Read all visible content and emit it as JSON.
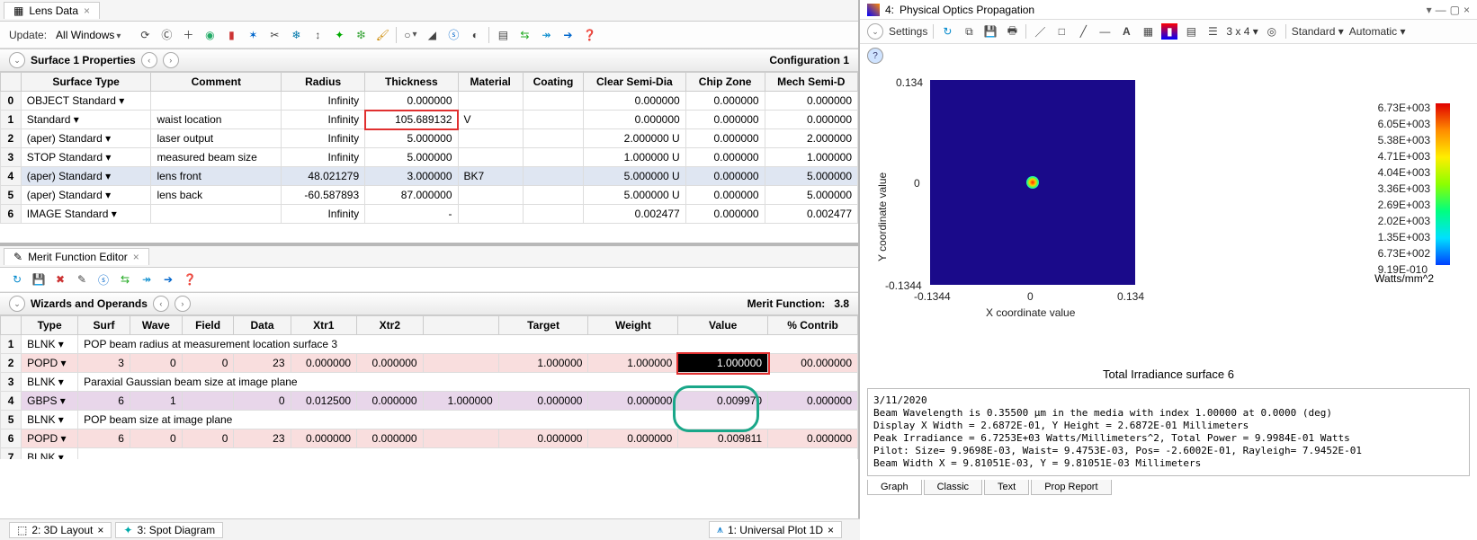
{
  "lens": {
    "tab_label": "Lens Data",
    "update_label": "Update:",
    "update_value": "All Windows",
    "surface_props": "Surface  1 Properties",
    "config_label": "Configuration 1",
    "columns": [
      "",
      "Surface Type",
      "Comment",
      "Radius",
      "Thickness",
      "Material",
      "Coating",
      "Clear Semi-Dia",
      "Chip Zone",
      "Mech Semi-D"
    ],
    "rows": [
      {
        "n": "0",
        "obj": "OBJECT",
        "type": "Standard ▾",
        "comment": "",
        "radius": "Infinity",
        "thickness": "0.000000",
        "material": "",
        "coating": "",
        "csd": "0.000000",
        "chip": "0.000000",
        "mech": "0.000000"
      },
      {
        "n": "1",
        "obj": "",
        "type": "Standard ▾",
        "comment": "waist location",
        "radius": "Infinity",
        "thickness": "105.689132",
        "material": "V",
        "coating": "",
        "csd": "0.000000",
        "chip": "0.000000",
        "mech": "0.000000"
      },
      {
        "n": "2",
        "obj": "(aper)",
        "type": "Standard ▾",
        "comment": "laser output",
        "radius": "Infinity",
        "thickness": "5.000000",
        "material": "",
        "coating": "",
        "csd": "2.000000 U",
        "chip": "0.000000",
        "mech": "2.000000"
      },
      {
        "n": "3",
        "obj": "STOP",
        "type": "Standard ▾",
        "comment": "measured beam size",
        "radius": "Infinity",
        "thickness": "5.000000",
        "material": "",
        "coating": "",
        "csd": "1.000000 U",
        "chip": "0.000000",
        "mech": "1.000000"
      },
      {
        "n": "4",
        "obj": "(aper)",
        "type": "Standard ▾",
        "comment": "lens front",
        "radius": "48.021279",
        "thickness": "3.000000",
        "material": "BK7",
        "coating": "",
        "csd": "5.000000 U",
        "chip": "0.000000",
        "mech": "5.000000"
      },
      {
        "n": "5",
        "obj": "(aper)",
        "type": "Standard ▾",
        "comment": "lens back",
        "radius": "-60.587893",
        "thickness": "87.000000",
        "material": "",
        "coating": "",
        "csd": "5.000000 U",
        "chip": "0.000000",
        "mech": "5.000000"
      },
      {
        "n": "6",
        "obj": "IMAGE",
        "type": "Standard ▾",
        "comment": "",
        "radius": "Infinity",
        "thickness": "-",
        "material": "",
        "coating": "",
        "csd": "0.002477",
        "chip": "0.000000",
        "mech": "0.002477"
      }
    ]
  },
  "merit": {
    "tab_label": "Merit Function Editor",
    "wizards": "Wizards and Operands",
    "mf_label": "Merit Function:",
    "mf_value": "3.8",
    "columns": [
      "",
      "Type",
      "Surf",
      "Wave",
      "Field",
      "Data",
      "Xtr1",
      "Xtr2",
      "",
      "Target",
      "Weight",
      "Value",
      "% Contrib"
    ],
    "rows": [
      {
        "n": "1",
        "type": "BLNK ▾",
        "note": "POP beam radius at measurement location surface 3"
      },
      {
        "n": "2",
        "type": "POPD ▾",
        "surf": "3",
        "wave": "0",
        "field": "0",
        "data": "23",
        "xtr1": "0.000000",
        "xtr2": "0.000000",
        "blank": "",
        "target": "1.000000",
        "weight": "1.000000",
        "value": "1.000000",
        "contrib": "00.000000",
        "pink": true,
        "sel": true
      },
      {
        "n": "3",
        "type": "BLNK ▾",
        "note": "Paraxial Gaussian beam size at image plane"
      },
      {
        "n": "4",
        "type": "GBPS ▾",
        "surf": "6",
        "wave": "1",
        "field": "",
        "data": "0",
        "xtr1": "0.012500",
        "xtr2": "0.000000",
        "x3": "1.000000",
        "target": "0.000000",
        "weight": "0.000000",
        "value": "0.009970",
        "contrib": "0.000000",
        "purple": true
      },
      {
        "n": "5",
        "type": "BLNK ▾",
        "note": "POP beam size at image plane"
      },
      {
        "n": "6",
        "type": "POPD ▾",
        "surf": "6",
        "wave": "0",
        "field": "0",
        "data": "23",
        "xtr1": "0.000000",
        "xtr2": "0.000000",
        "blank": "",
        "target": "0.000000",
        "weight": "0.000000",
        "value": "0.009811",
        "contrib": "0.000000",
        "pink": true
      },
      {
        "n": "7",
        "type": "BLNK ▾",
        "note": ""
      }
    ]
  },
  "bottom": {
    "t1": "2: 3D Layout",
    "t2": "3: Spot Diagram",
    "t3": "1: Universal Plot 1D"
  },
  "pop": {
    "title_num": "4:",
    "title": "Physical Optics Propagation",
    "settings": "Settings",
    "grid": "3 x 4 ▾",
    "standard": "Standard ▾",
    "automatic": "Automatic ▾",
    "ylabel": "Y coordinate value",
    "xlabel": "X coordinate value",
    "y_top": "0.134",
    "y_mid": "0",
    "y_bot": "-0.1344",
    "x_left": "-0.1344",
    "x_mid": "0",
    "x_right": "0.134",
    "cbar": [
      "6.73E+003",
      "6.05E+003",
      "5.38E+003",
      "4.71E+003",
      "4.04E+003",
      "3.36E+003",
      "2.69E+003",
      "2.02E+003",
      "1.35E+003",
      "6.73E+002",
      "9.19E-010"
    ],
    "cbar_unit": "Watts/mm^2",
    "plot_title": "Total Irradiance surface 6",
    "info": "3/11/2020\nBeam Wavelength is 0.35500 µm in the media with index 1.00000 at 0.0000 (deg)\nDisplay X Width = 2.6872E-01, Y Height = 2.6872E-01 Millimeters\nPeak Irradiance = 6.7253E+03 Watts/Millimeters^2, Total Power = 9.9984E-01 Watts\nPilot: Size= 9.9698E-03, Waist= 9.4753E-03, Pos= -2.6002E-01, Rayleigh= 7.9452E-01\nBeam Width X = 9.81051E-03, Y = 9.81051E-03 Millimeters",
    "tabs": [
      "Graph",
      "Classic",
      "Text",
      "Prop Report"
    ]
  },
  "chart_data": {
    "type": "heatmap",
    "title": "Total Irradiance surface 6",
    "xlabel": "X coordinate value",
    "ylabel": "Y coordinate value",
    "xlim": [
      -0.1344,
      0.134
    ],
    "ylim": [
      -0.1344,
      0.134
    ],
    "colorbar_label": "Watts/mm^2",
    "clim": [
      9.19e-10,
      6730.0
    ],
    "peak": {
      "x": 0,
      "y": 0,
      "value": 6725.3
    },
    "note": "single Gaussian-like irradiance spot centered at origin on near-zero blue background"
  }
}
